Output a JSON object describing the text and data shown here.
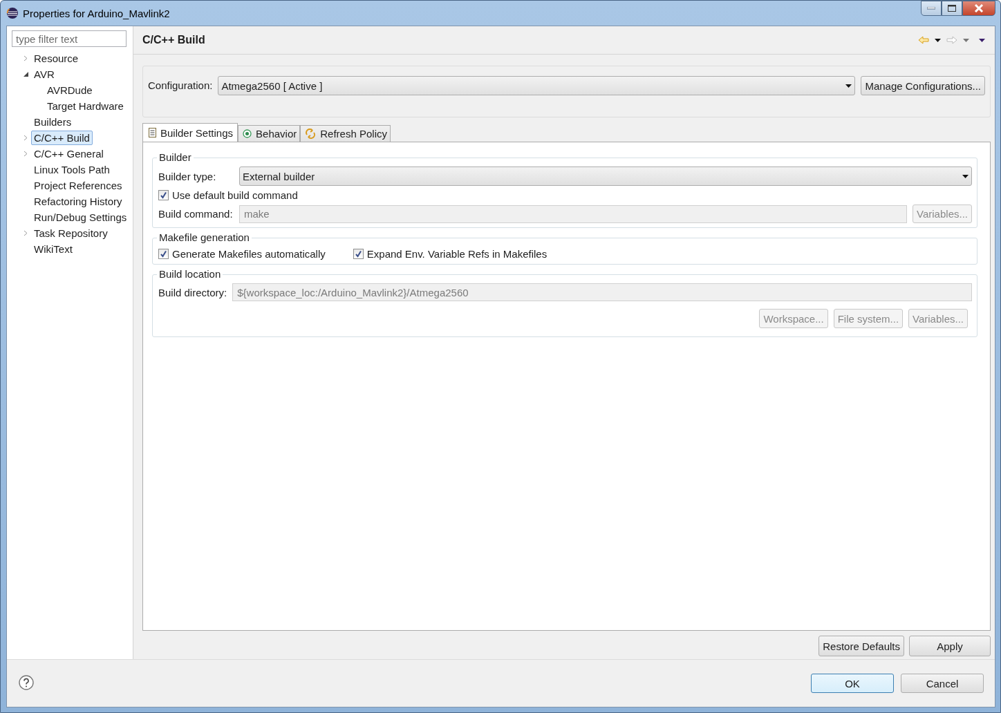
{
  "window": {
    "title": "Properties for Arduino_Mavlink2"
  },
  "sidebar": {
    "filter": {
      "placeholder": "type filter text"
    },
    "items": [
      {
        "label": "Resource",
        "expanded": false,
        "selected": false
      },
      {
        "label": "AVR",
        "expanded": true,
        "selected": false,
        "children": [
          {
            "label": "AVRDude",
            "selected": false
          },
          {
            "label": "Target Hardware",
            "selected": false
          }
        ]
      },
      {
        "label": "Builders",
        "selected": false
      },
      {
        "label": "C/C++ Build",
        "expanded": false,
        "selected": true
      },
      {
        "label": "C/C++ General",
        "expanded": false,
        "selected": false
      },
      {
        "label": "Linux Tools Path",
        "selected": false
      },
      {
        "label": "Project References",
        "selected": false
      },
      {
        "label": "Refactoring History",
        "selected": false
      },
      {
        "label": "Run/Debug Settings",
        "selected": false
      },
      {
        "label": "Task Repository",
        "expanded": false,
        "selected": false
      },
      {
        "label": "WikiText",
        "selected": false
      }
    ]
  },
  "page": {
    "title": "C/C++ Build",
    "configuration": {
      "label": "Configuration:",
      "value": "Atmega2560  [ Active ]",
      "button": "Manage Configurations..."
    },
    "tabs": [
      {
        "label": "Builder Settings",
        "selected": true,
        "kind": "list"
      },
      {
        "label": "Behavior",
        "selected": false,
        "kind": "radio"
      },
      {
        "label": "Refresh Policy",
        "selected": false,
        "kind": "refresh"
      }
    ],
    "builder": {
      "title": "Builder",
      "type_label": "Builder type:",
      "type_value": "External builder",
      "use_default": {
        "label": "Use default build command",
        "checked": true
      },
      "command_label": "Build command:",
      "command_value": "make",
      "command_disabled": true,
      "variables_button": {
        "label": "Variables...",
        "disabled": true
      }
    },
    "makefile": {
      "title": "Makefile generation",
      "options": [
        {
          "label": "Generate Makefiles automatically",
          "checked": true
        },
        {
          "label": "Expand Env. Variable Refs in Makefiles",
          "checked": true
        }
      ]
    },
    "location": {
      "title": "Build location",
      "directory_label": "Build directory:",
      "directory_value": "${workspace_loc:/Arduino_Mavlink2}/Atmega2560",
      "directory_disabled": true,
      "buttons": [
        {
          "label": "Workspace...",
          "disabled": true
        },
        {
          "label": "File system...",
          "disabled": true
        },
        {
          "label": "Variables...",
          "disabled": true
        }
      ]
    },
    "actions": [
      "Restore Defaults",
      "Apply"
    ]
  },
  "buttons": [
    {
      "label": "OK",
      "default": true
    },
    {
      "label": "Cancel",
      "default": false
    }
  ]
}
